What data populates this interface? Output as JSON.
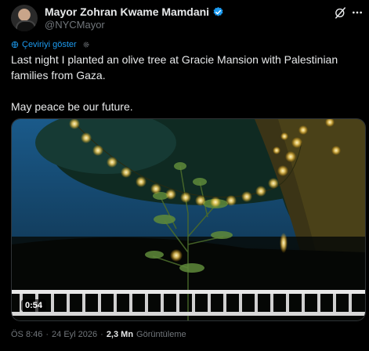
{
  "tweet": {
    "author_name": "Mayor Zohran Kwame Mamdani",
    "author_handle": "@NYCMayor",
    "translate_label": "Çeviriyi göster",
    "text": "Last night I planted an olive tree at Gracie Mansion with Palestinian families from Gaza.\n\nMay peace be our future.",
    "video_duration": "0:54",
    "time": "ÖS 8:46",
    "separator": "·",
    "date": "24 Eyl 2026",
    "views_count": "2,3 Mn",
    "views_label": "Görüntüleme"
  },
  "icons": {
    "verified": "verified-badge-icon",
    "grok": "grok-icon",
    "more": "more-icon",
    "globe": "globe-icon",
    "gear": "gear-icon"
  },
  "colors": {
    "accent": "#1d9bf0",
    "background": "#000000",
    "text": "#e7e9ea",
    "muted": "#71767b"
  }
}
